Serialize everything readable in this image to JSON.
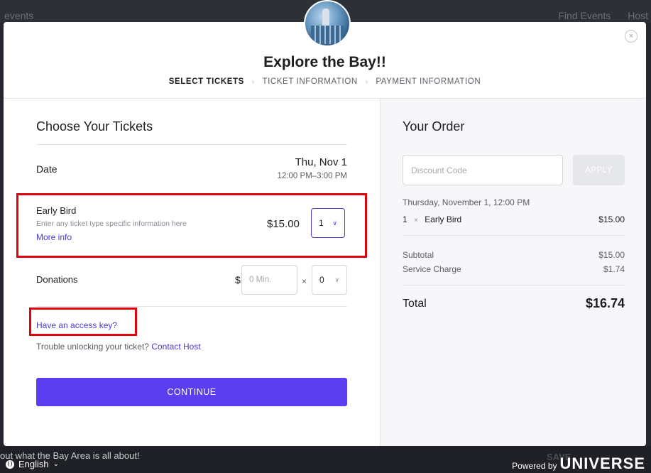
{
  "background": {
    "nav_left": "events",
    "nav_right": [
      "Find Events",
      "Host"
    ],
    "teaser": "out what the Bay Area is all about!",
    "save_ghost": "SAVE",
    "language": "English",
    "language_chevron": "⌄",
    "powered_prefix": "Powered by",
    "powered_brand": "UNIVERSE"
  },
  "modal": {
    "close_glyph": "×",
    "event_title": "Explore the Bay!!",
    "steps": [
      "SELECT TICKETS",
      "TICKET INFORMATION",
      "PAYMENT INFORMATION"
    ],
    "step_separator": "›"
  },
  "tickets": {
    "heading": "Choose Your Tickets",
    "date_label": "Date",
    "date_value": "Thu, Nov 1",
    "time_value": "12:00 PM–3:00 PM",
    "ticket_name": "Early Bird",
    "ticket_desc": "Enter any ticket type specific information here",
    "more_info": "More info",
    "ticket_price": "$15.00",
    "ticket_qty": "1",
    "donations_label": "Donations",
    "donation_currency": "$",
    "donation_placeholder": "0 Min.",
    "donation_times": "×",
    "donation_qty": "0",
    "access_key": "Have an access key?",
    "trouble_text": "Trouble unlocking your ticket?",
    "contact_host": "Contact Host",
    "continue": "CONTINUE"
  },
  "order": {
    "heading": "Your Order",
    "discount_placeholder": "Discount Code",
    "apply": "APPLY",
    "date_line": "Thursday, November 1, 12:00 PM",
    "item_qty": "1",
    "item_times": "×",
    "item_name": "Early Bird",
    "item_amount": "$15.00",
    "subtotal_label": "Subtotal",
    "subtotal": "$15.00",
    "service_label": "Service Charge",
    "service": "$1.74",
    "total_label": "Total",
    "total": "$16.74"
  },
  "colors": {
    "accent": "#5a3ef0",
    "link": "#4a3bd0",
    "highlight": "#e3000f"
  },
  "icons": {
    "close": "close-icon",
    "chevron": "chevron-down-icon",
    "globe": "globe-icon"
  }
}
